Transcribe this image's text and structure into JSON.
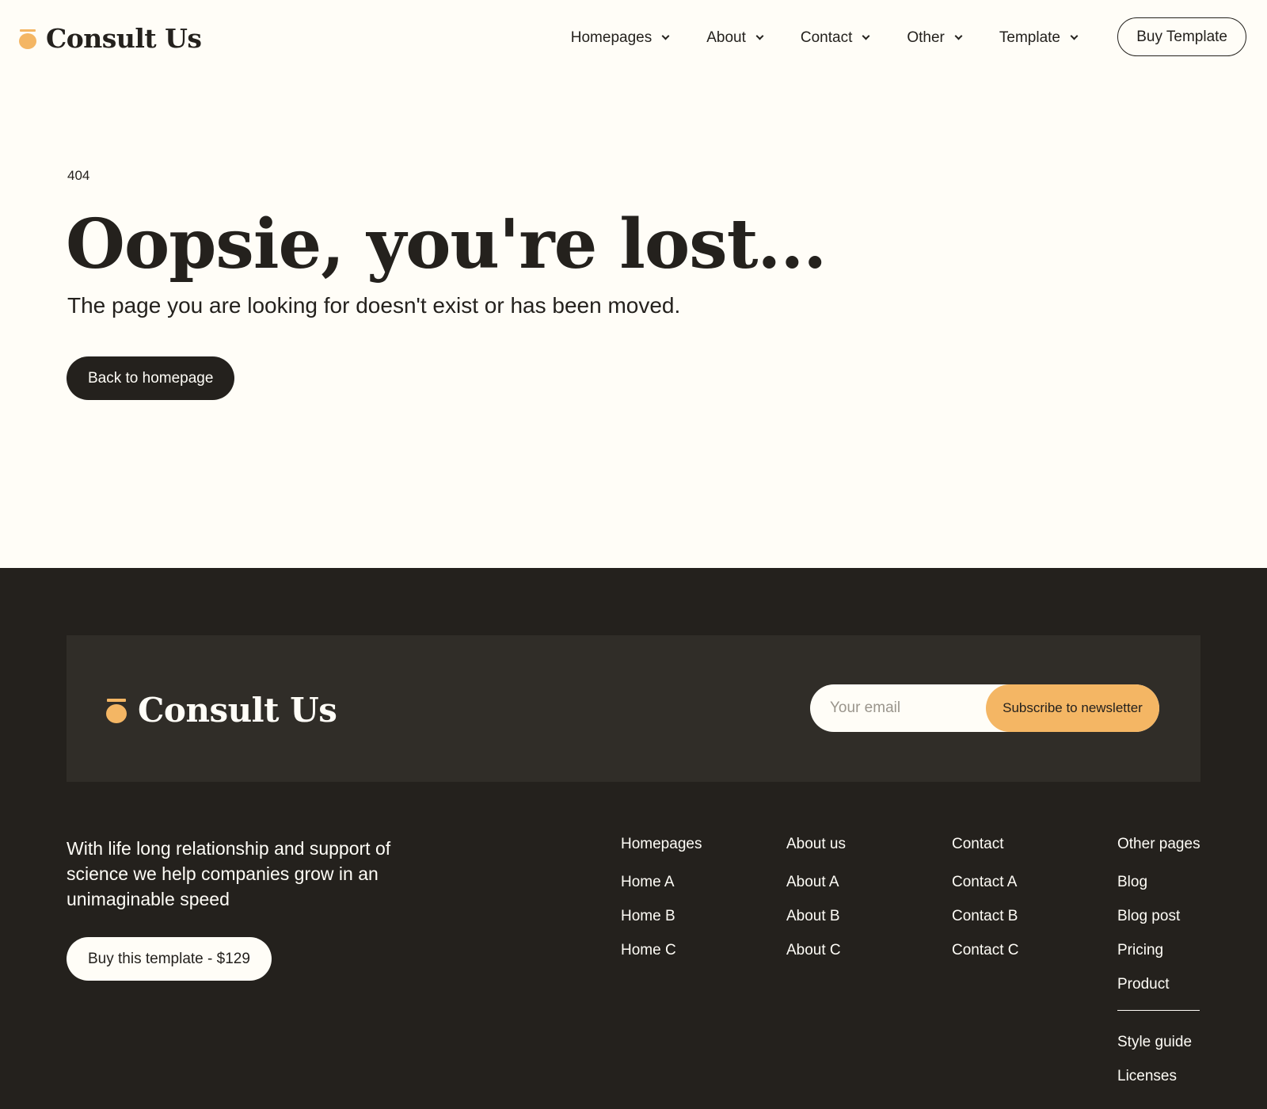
{
  "brand": {
    "name": "Consult Us",
    "accent_color": "#f4b664",
    "dark_color": "#24211d",
    "light_color": "#fffdf7"
  },
  "header": {
    "nav": [
      {
        "label": "Homepages",
        "icon": "chevron-down-icon"
      },
      {
        "label": "About",
        "icon": "chevron-down-icon"
      },
      {
        "label": "Contact",
        "icon": "chevron-down-icon"
      },
      {
        "label": "Other",
        "icon": "chevron-down-icon"
      },
      {
        "label": "Template",
        "icon": "chevron-down-icon"
      }
    ],
    "cta_label": "Buy Template"
  },
  "hero": {
    "eyebrow": "404",
    "title": "Oopsie, you're lost...",
    "subtitle": "The page you are looking for doesn't exist or has been moved.",
    "button_label": "Back to homepage"
  },
  "footer": {
    "newsletter": {
      "email_placeholder": "Your email",
      "button_label": "Subscribe to newsletter"
    },
    "tagline": "With life long relationship and support of science we help companies grow in an unimaginable speed",
    "cta_label": "Buy this template - $129",
    "columns": [
      {
        "title": "Homepages",
        "links": [
          "Home A",
          "Home B",
          "Home C"
        ]
      },
      {
        "title": "About us",
        "links": [
          "About A",
          "About B",
          "About C"
        ]
      },
      {
        "title": "Contact",
        "links": [
          "Contact A",
          "Contact B",
          "Contact C"
        ]
      },
      {
        "title": "Other pages",
        "links": [
          "Blog",
          "Blog post",
          "Pricing",
          "Product"
        ],
        "extra_links": [
          "Style guide",
          "Licenses"
        ]
      }
    ]
  }
}
